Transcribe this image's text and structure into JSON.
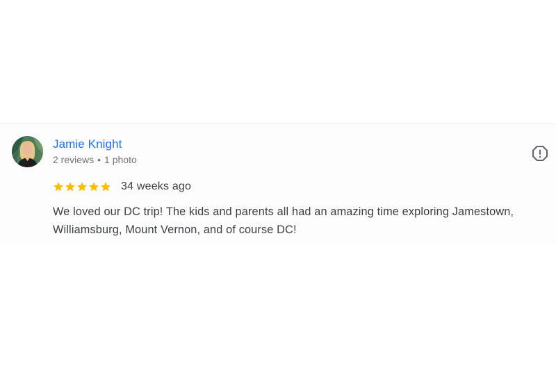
{
  "review": {
    "author": {
      "name": "Jamie Knight",
      "reviews_count": "2 reviews",
      "separator": "•",
      "photos_count": "1 photo",
      "avatar_icon": "user-avatar-photo"
    },
    "rating": 5,
    "max_rating": 5,
    "star_color": "#fbbc04",
    "time_ago": "34 weeks ago",
    "text": "We loved our DC trip! The kids and parents all had an amazing time exploring Jamestown, Williamsburg, Mount Vernon, and of course DC!",
    "flag_icon": "report-flag-icon"
  },
  "colors": {
    "author_link": "#1a73e8",
    "meta_text": "#70757a",
    "body_text": "#3c4043",
    "icon": "#5f6368"
  }
}
